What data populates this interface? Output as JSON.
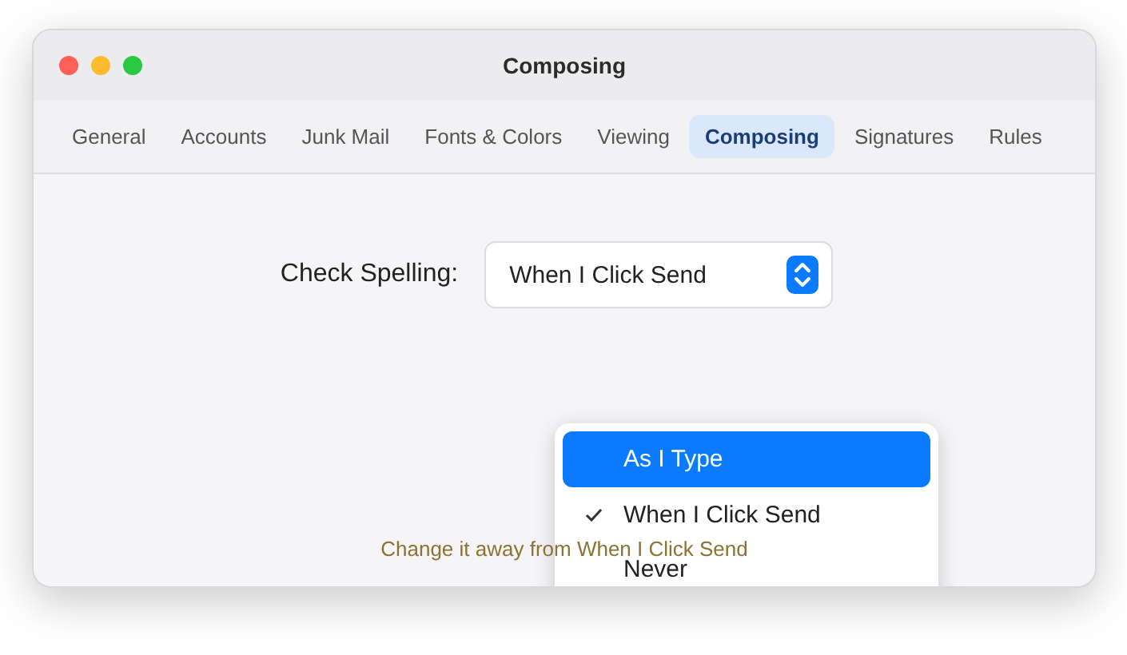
{
  "window": {
    "title": "Composing"
  },
  "tabs": [
    {
      "label": "General",
      "selected": false
    },
    {
      "label": "Accounts",
      "selected": false
    },
    {
      "label": "Junk Mail",
      "selected": false
    },
    {
      "label": "Fonts & Colors",
      "selected": false
    },
    {
      "label": "Viewing",
      "selected": false
    },
    {
      "label": "Composing",
      "selected": true
    },
    {
      "label": "Signatures",
      "selected": false
    },
    {
      "label": "Rules",
      "selected": false
    }
  ],
  "check_spelling": {
    "label": "Check Spelling:",
    "value": "When I Click Send"
  },
  "menu": {
    "items": [
      {
        "label": "As I Type",
        "checked": false,
        "highlighted": true
      },
      {
        "label": "When I Click Send",
        "checked": true,
        "highlighted": false
      },
      {
        "label": "Never",
        "checked": false,
        "highlighted": false
      }
    ]
  },
  "hint": "Change it away from When I Click Send"
}
